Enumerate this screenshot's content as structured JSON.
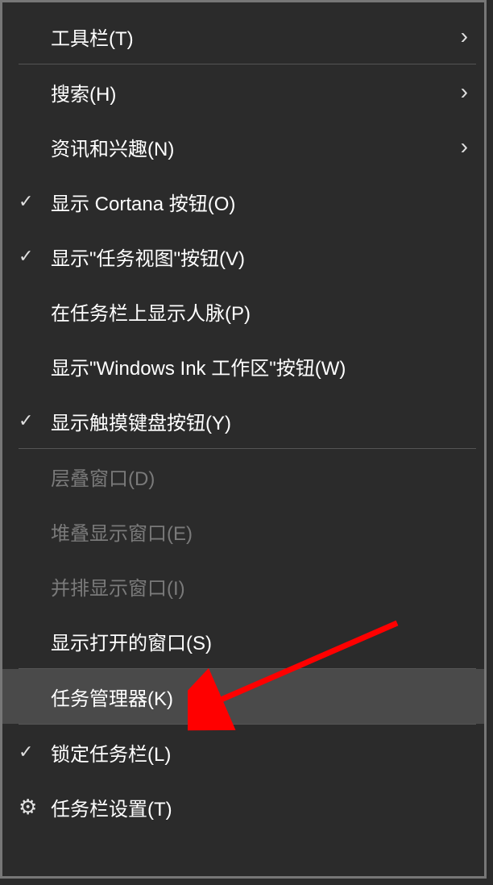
{
  "menu": {
    "toolbars": {
      "label": "工具栏(T)",
      "checked": false,
      "submenu": true,
      "disabled": false,
      "highlight": false,
      "icon": null
    },
    "search": {
      "label": "搜索(H)",
      "checked": false,
      "submenu": true,
      "disabled": false,
      "highlight": false,
      "icon": null
    },
    "news": {
      "label": "资讯和兴趣(N)",
      "checked": false,
      "submenu": true,
      "disabled": false,
      "highlight": false,
      "icon": null
    },
    "cortana": {
      "label": "显示 Cortana 按钮(O)",
      "checked": true,
      "submenu": false,
      "disabled": false,
      "highlight": false,
      "icon": null
    },
    "taskview": {
      "label": "显示\"任务视图\"按钮(V)",
      "checked": true,
      "submenu": false,
      "disabled": false,
      "highlight": false,
      "icon": null
    },
    "people": {
      "label": "在任务栏上显示人脉(P)",
      "checked": false,
      "submenu": false,
      "disabled": false,
      "highlight": false,
      "icon": null
    },
    "ink": {
      "label": "显示\"Windows Ink 工作区\"按钮(W)",
      "checked": false,
      "submenu": false,
      "disabled": false,
      "highlight": false,
      "icon": null
    },
    "touchkbd": {
      "label": "显示触摸键盘按钮(Y)",
      "checked": true,
      "submenu": false,
      "disabled": false,
      "highlight": false,
      "icon": null
    },
    "cascade": {
      "label": "层叠窗口(D)",
      "checked": false,
      "submenu": false,
      "disabled": true,
      "highlight": false,
      "icon": null
    },
    "stacked": {
      "label": "堆叠显示窗口(E)",
      "checked": false,
      "submenu": false,
      "disabled": true,
      "highlight": false,
      "icon": null
    },
    "sidebyside": {
      "label": "并排显示窗口(I)",
      "checked": false,
      "submenu": false,
      "disabled": true,
      "highlight": false,
      "icon": null
    },
    "showopen": {
      "label": "显示打开的窗口(S)",
      "checked": false,
      "submenu": false,
      "disabled": false,
      "highlight": false,
      "icon": null
    },
    "taskmgr": {
      "label": "任务管理器(K)",
      "checked": false,
      "submenu": false,
      "disabled": false,
      "highlight": true,
      "icon": null
    },
    "lock": {
      "label": "锁定任务栏(L)",
      "checked": true,
      "submenu": false,
      "disabled": false,
      "highlight": false,
      "icon": null
    },
    "settings": {
      "label": "任务栏设置(T)",
      "checked": false,
      "submenu": false,
      "disabled": false,
      "highlight": false,
      "icon": "gear"
    }
  },
  "annotation": {
    "arrow_color": "#ff0000",
    "target": "taskmgr"
  }
}
